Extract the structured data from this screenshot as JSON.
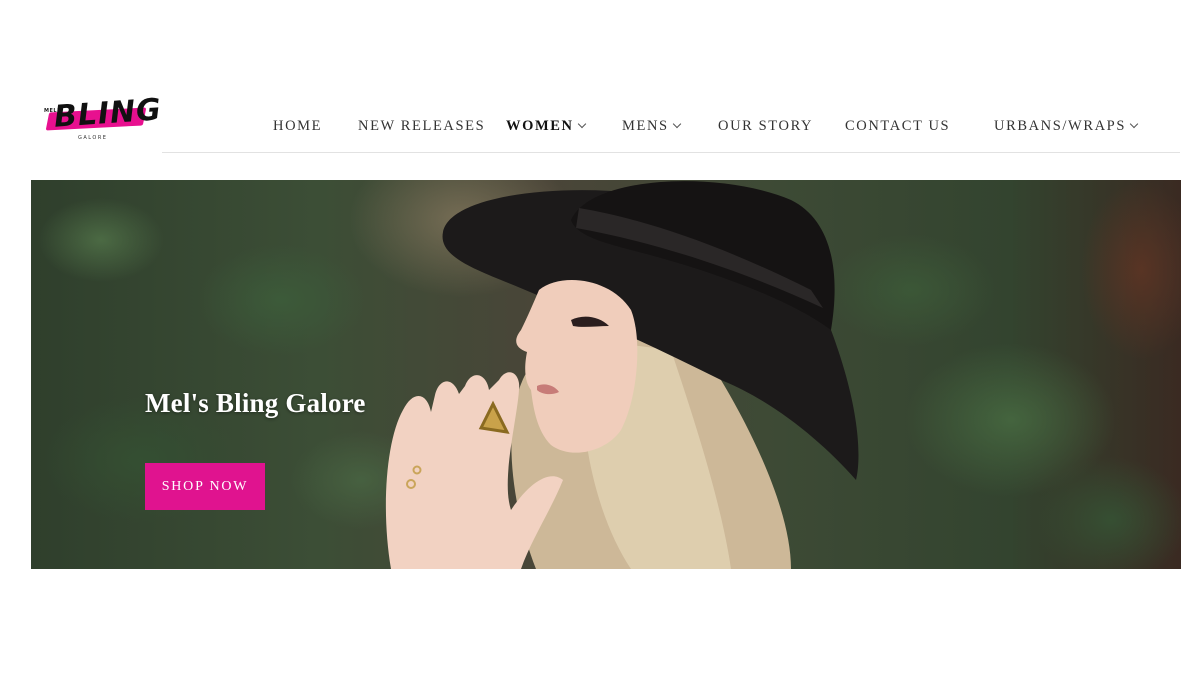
{
  "brand": {
    "logo_small_text": "MEL'S",
    "logo_main_text": "BLING",
    "logo_sub_text": "GALORE",
    "accent_color": "#e0138f"
  },
  "nav": {
    "items": [
      {
        "label": "HOME",
        "has_dropdown": false,
        "active": false
      },
      {
        "label": "NEW RELEASES",
        "has_dropdown": false,
        "active": false
      },
      {
        "label": "WOMEN",
        "has_dropdown": true,
        "active": true
      },
      {
        "label": "MENS",
        "has_dropdown": true,
        "active": false
      },
      {
        "label": "OUR STORY",
        "has_dropdown": false,
        "active": false
      },
      {
        "label": "CONTACT US",
        "has_dropdown": false,
        "active": false
      },
      {
        "label": "URBANS/WRAPS",
        "has_dropdown": true,
        "active": false
      }
    ],
    "dropdown_icon": "chevron-down-icon"
  },
  "hero": {
    "title": "Mel's Bling Galore",
    "button_label": "SHOP NOW",
    "button_color": "#e0138f"
  }
}
